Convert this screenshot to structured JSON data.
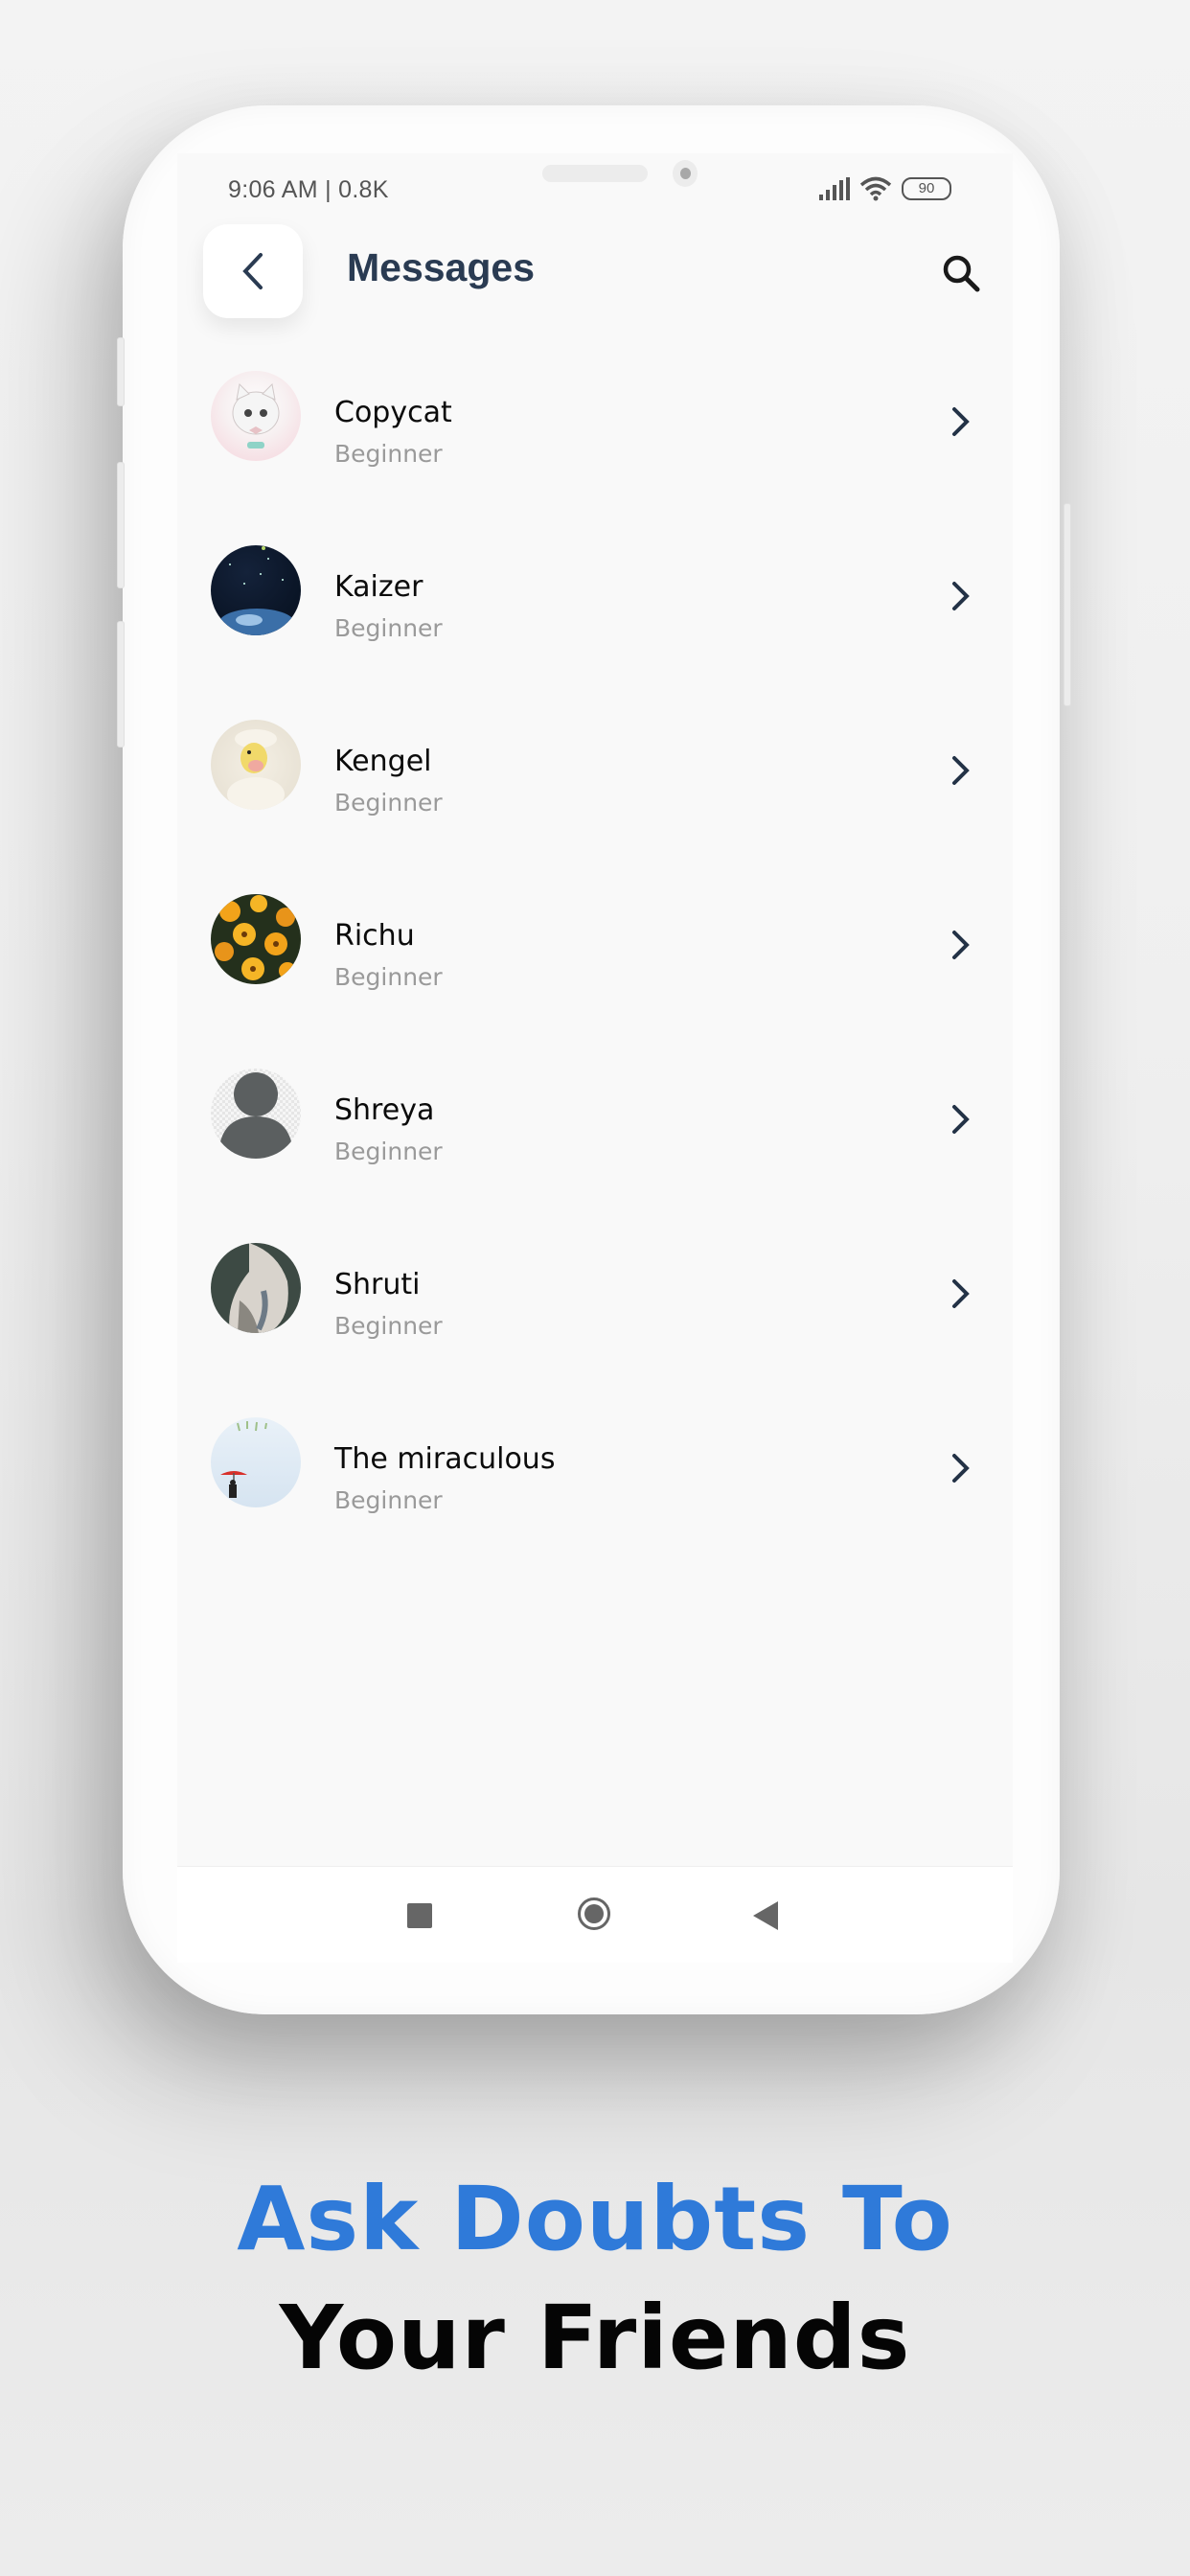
{
  "status_bar": {
    "time": "9:06 AM | 0.8K",
    "battery": "90",
    "icons": [
      "signal-icon",
      "wifi-icon",
      "battery-icon"
    ]
  },
  "header": {
    "back_icon": "chevron-left-icon",
    "title": "Messages",
    "search_icon": "search-icon"
  },
  "contacts": [
    {
      "name": "Copycat",
      "level": "Beginner",
      "avatar": "cat-illustration"
    },
    {
      "name": "Kaizer",
      "level": "Beginner",
      "avatar": "night-sky"
    },
    {
      "name": "Kengel",
      "level": "Beginner",
      "avatar": "duckling"
    },
    {
      "name": "Richu",
      "level": "Beginner",
      "avatar": "yellow-flowers"
    },
    {
      "name": "Shreya",
      "level": "Beginner",
      "avatar": "default-person"
    },
    {
      "name": "Shruti",
      "level": "Beginner",
      "avatar": "bird"
    },
    {
      "name": "The miraculous",
      "level": "Beginner",
      "avatar": "umbrella-rain"
    }
  ],
  "nav_bar": {
    "recent_icon": "square-icon",
    "home_icon": "circle-icon",
    "back_icon": "triangle-back-icon"
  },
  "promo": {
    "line1": "Ask Doubts To",
    "line2": "Your Friends",
    "accent_color": "#2f7ad9"
  }
}
